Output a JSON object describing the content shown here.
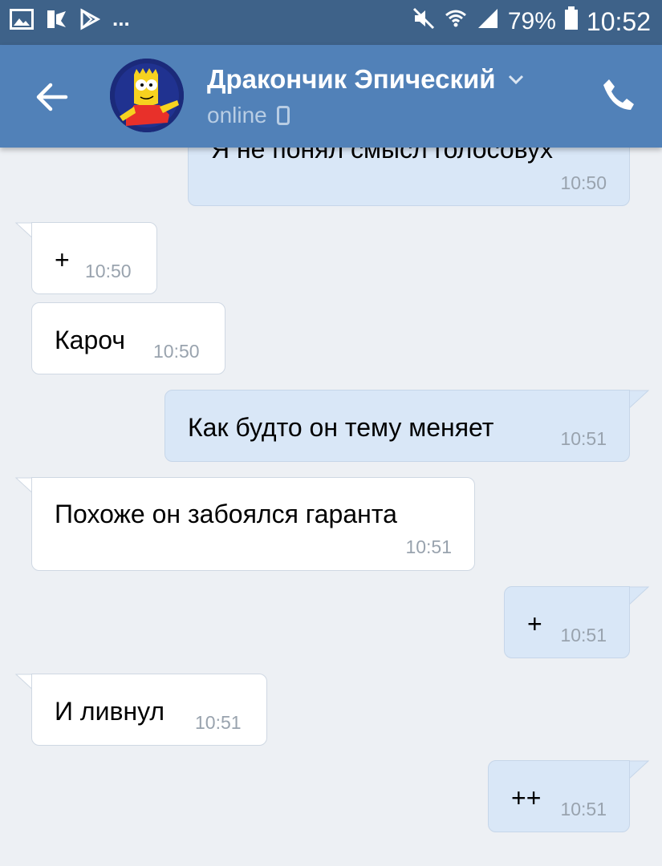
{
  "status_bar": {
    "icons_left": [
      "gallery-icon",
      "notification-icon",
      "play-store-icon"
    ],
    "more": "...",
    "battery_percent": "79%",
    "time": "10:52",
    "icons_right": [
      "mute-icon",
      "wifi-icon",
      "signal-icon",
      "battery-icon"
    ]
  },
  "header": {
    "contact_name": "Дракончик Эпический",
    "status": "online",
    "status_device_icon": "mobile-icon"
  },
  "messages": [
    {
      "direction": "out",
      "text": "Я не понял смысл голосовух",
      "time": "10:50"
    },
    {
      "direction": "in",
      "text": "+",
      "time": "10:50"
    },
    {
      "direction": "in",
      "text": "Кароч",
      "time": "10:50"
    },
    {
      "direction": "out",
      "text": "Как будто он тему меняет",
      "time": "10:51"
    },
    {
      "direction": "in",
      "text": "Похоже он забоялся гаранта",
      "time": "10:51"
    },
    {
      "direction": "out",
      "text": "+",
      "time": "10:51"
    },
    {
      "direction": "in",
      "text": "И ливнул",
      "time": "10:51"
    },
    {
      "direction": "out",
      "text": "++",
      "time": "10:51"
    }
  ]
}
